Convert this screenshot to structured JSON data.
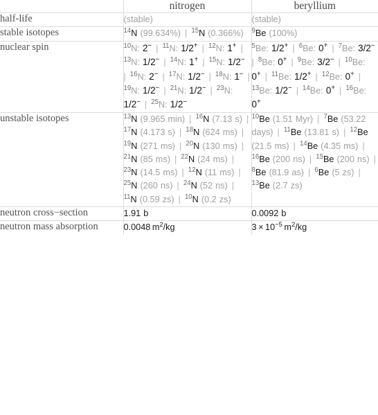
{
  "table": {
    "corner_label": "",
    "columns": [
      "nitrogen",
      "beryllium"
    ],
    "rows": [
      {
        "label": "half-life"
      },
      {
        "label": "stable isotopes"
      },
      {
        "label": "nuclear spin"
      },
      {
        "label": "unstable isotopes"
      },
      {
        "label": "neutron cross−section"
      },
      {
        "label": "neutron mass absorption"
      }
    ]
  },
  "half_life": {
    "nitrogen": "(stable)",
    "beryllium": "(stable)"
  },
  "stable_isotopes": {
    "nitrogen": [
      {
        "mass": "14",
        "element": "N",
        "value": "(99.634%)"
      },
      {
        "mass": "15",
        "element": "N",
        "value": "(0.366%)"
      }
    ],
    "beryllium": [
      {
        "mass": "9",
        "element": "Be",
        "value": "(100%)"
      }
    ]
  },
  "nuclear_spin": {
    "nitrogen": [
      {
        "mass": "10",
        "element": "N",
        "spin": "2",
        "sign": "−"
      },
      {
        "mass": "11",
        "element": "N",
        "spin": "1/2",
        "sign": "+"
      },
      {
        "mass": "12",
        "element": "N",
        "spin": "1",
        "sign": "+"
      },
      {
        "mass": "13",
        "element": "N",
        "spin": "1/2",
        "sign": "−"
      },
      {
        "mass": "14",
        "element": "N",
        "spin": "1",
        "sign": "+"
      },
      {
        "mass": "15",
        "element": "N",
        "spin": "1/2",
        "sign": "−"
      },
      {
        "mass": "16",
        "element": "N",
        "spin": "2",
        "sign": "−"
      },
      {
        "mass": "17",
        "element": "N",
        "spin": "1/2",
        "sign": "−"
      },
      {
        "mass": "18",
        "element": "N",
        "spin": "1",
        "sign": "−"
      },
      {
        "mass": "19",
        "element": "N",
        "spin": "1/2",
        "sign": "−"
      },
      {
        "mass": "21",
        "element": "N",
        "spin": "1/2",
        "sign": "−"
      },
      {
        "mass": "23",
        "element": "N",
        "spin": "1/2",
        "sign": "−"
      },
      {
        "mass": "25",
        "element": "N",
        "spin": "1/2",
        "sign": "−"
      }
    ],
    "beryllium": [
      {
        "mass": "5",
        "element": "Be",
        "spin": "1/2",
        "sign": "+"
      },
      {
        "mass": "6",
        "element": "Be",
        "spin": "0",
        "sign": "+"
      },
      {
        "mass": "7",
        "element": "Be",
        "spin": "3/2",
        "sign": "−"
      },
      {
        "mass": "8",
        "element": "Be",
        "spin": "0",
        "sign": "+"
      },
      {
        "mass": "9",
        "element": "Be",
        "spin": "3/2",
        "sign": "−"
      },
      {
        "mass": "10",
        "element": "Be",
        "spin": "0",
        "sign": "+"
      },
      {
        "mass": "11",
        "element": "Be",
        "spin": "1/2",
        "sign": "+"
      },
      {
        "mass": "12",
        "element": "Be",
        "spin": "0",
        "sign": "+"
      },
      {
        "mass": "13",
        "element": "Be",
        "spin": "1/2",
        "sign": "−"
      },
      {
        "mass": "14",
        "element": "Be",
        "spin": "0",
        "sign": "+"
      },
      {
        "mass": "16",
        "element": "Be",
        "spin": "0",
        "sign": "+"
      }
    ]
  },
  "unstable_isotopes": {
    "nitrogen": [
      {
        "mass": "13",
        "element": "N",
        "value": "(9.965 min)"
      },
      {
        "mass": "16",
        "element": "N",
        "value": "(7.13 s)"
      },
      {
        "mass": "17",
        "element": "N",
        "value": "(4.173 s)"
      },
      {
        "mass": "18",
        "element": "N",
        "value": "(624 ms)"
      },
      {
        "mass": "19",
        "element": "N",
        "value": "(271 ms)"
      },
      {
        "mass": "20",
        "element": "N",
        "value": "(130 ms)"
      },
      {
        "mass": "21",
        "element": "N",
        "value": "(85 ms)"
      },
      {
        "mass": "22",
        "element": "N",
        "value": "(24 ms)"
      },
      {
        "mass": "23",
        "element": "N",
        "value": "(14.5 ms)"
      },
      {
        "mass": "12",
        "element": "N",
        "value": "(11 ms)"
      },
      {
        "mass": "25",
        "element": "N",
        "value": "(260 ns)"
      },
      {
        "mass": "24",
        "element": "N",
        "value": "(52 ns)"
      },
      {
        "mass": "11",
        "element": "N",
        "value": "(0.59 zs)"
      },
      {
        "mass": "10",
        "element": "N",
        "value": "(0.2 zs)"
      }
    ],
    "beryllium": [
      {
        "mass": "10",
        "element": "Be",
        "value": "(1.51 Myr)"
      },
      {
        "mass": "7",
        "element": "Be",
        "value": "(53.22 days)"
      },
      {
        "mass": "11",
        "element": "Be",
        "value": "(13.81 s)"
      },
      {
        "mass": "12",
        "element": "Be",
        "value": "(21.5 ms)"
      },
      {
        "mass": "14",
        "element": "Be",
        "value": "(4.35 ms)"
      },
      {
        "mass": "16",
        "element": "Be",
        "value": "(200 ns)"
      },
      {
        "mass": "15",
        "element": "Be",
        "value": "(200 ns)"
      },
      {
        "mass": "8",
        "element": "Be",
        "value": "(81.9 as)"
      },
      {
        "mass": "6",
        "element": "Be",
        "value": "(5 zs)"
      },
      {
        "mass": "13",
        "element": "Be",
        "value": "(2.7 zs)"
      }
    ]
  },
  "neutron_cross_section": {
    "nitrogen": "1.91 b",
    "beryllium": "0.0092 b"
  },
  "neutron_mass_absorption": {
    "nitrogen": {
      "mantissa": "0.0048",
      "unit_base": "m",
      "unit_exp": "2",
      "unit_tail": "/kg"
    },
    "beryllium": {
      "mantissa": "3",
      "times": "×",
      "base": "10",
      "exponent": "−5",
      "unit_base": "m",
      "unit_exp": "2",
      "unit_tail": "/kg"
    }
  }
}
